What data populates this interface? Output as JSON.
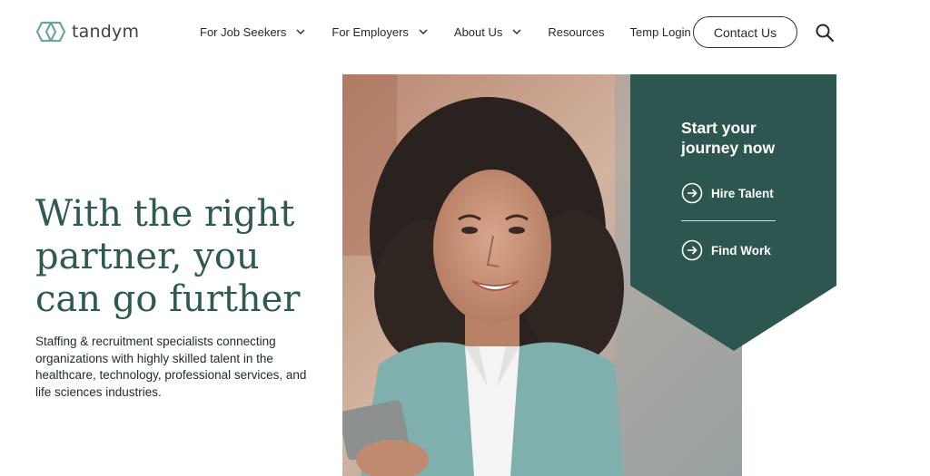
{
  "brand": {
    "name": "tandym",
    "color": "#2f5a52",
    "logo_icon": "hexagon-link-logo-icon"
  },
  "nav": {
    "items": [
      {
        "label": "For Job Seekers",
        "has_dropdown": true
      },
      {
        "label": "For Employers",
        "has_dropdown": true
      },
      {
        "label": "About Us",
        "has_dropdown": true
      },
      {
        "label": "Resources",
        "has_dropdown": false
      },
      {
        "label": "Temp Login",
        "has_dropdown": false
      }
    ],
    "contact_label": "Contact Us",
    "search_icon": "search-icon"
  },
  "hero": {
    "title": "With the right partner, you can go further",
    "subtitle": "Staffing & recruitment specialists connecting organizations with highly skilled talent in the healthcare, technology, professional services, and life sciences industries."
  },
  "cta": {
    "title": "Start your journey now",
    "links": [
      {
        "label": "Hire Talent",
        "icon": "arrow-circle-right-icon"
      },
      {
        "label": "Find Work",
        "icon": "arrow-circle-right-icon"
      }
    ],
    "panel_color": "#2d5650"
  }
}
